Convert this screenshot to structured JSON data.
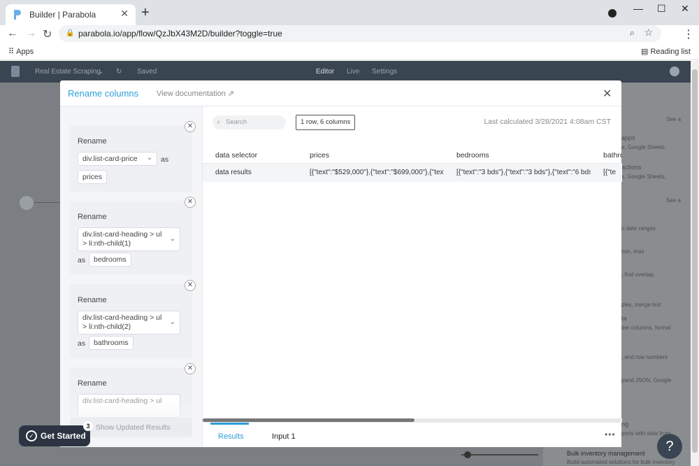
{
  "browser": {
    "tab_title": "Builder | Parabola",
    "url": "parabola.io/app/flow/QzJbX43M2D/builder?toggle=true",
    "apps_label": "Apps",
    "reading_list_label": "Reading list"
  },
  "appbar": {
    "flow_name": "Real Estate Scraping",
    "saved_label": "Saved",
    "tabs": [
      "Editor",
      "Live",
      "Settings"
    ]
  },
  "background": {
    "panel_texts": [
      "See a",
      "apps",
      "e, Google Sheets,",
      "actions",
      "s, Google Sheets,",
      "See a",
      "n date ranges",
      "min, max",
      ", find overlap,",
      "ples, merge text",
      "ta",
      "der columns, format",
      ", and row numbers",
      "pand JSON, Google",
      "ng",
      "ports with data from",
      "Bulk inventory management",
      "Build automated solutions for bulk inventory"
    ],
    "help_label": "?",
    "get_started_label": "Get Started",
    "get_started_count": "3"
  },
  "modal": {
    "title": "Rename columns",
    "view_doc_label": "View documentation",
    "rename_label": "Rename",
    "as_label": "as",
    "renames": [
      {
        "from": "div.list-card-price",
        "to": "prices"
      },
      {
        "from_line1": "div.list-card-heading > ul",
        "from_line2": "> li:nth-child(1)",
        "to": "bedrooms"
      },
      {
        "from_line1": "div.list-card-heading > ul",
        "from_line2": "> li:nth-child(2)",
        "to": "bathrooms"
      },
      {
        "from_line1": "div.list-card-heading > ul"
      }
    ],
    "show_updated_label": "Show Updated Results",
    "search_placeholder": "Search",
    "rows_badge": "1 row, 6 columns",
    "last_calculated": "Last calculated 3/28/2021 4:08am CST",
    "table": {
      "columns": [
        "data selector",
        "prices",
        "bedrooms",
        "bathrooms"
      ],
      "rows": [
        [
          "data results",
          "[{\"text\":\"$529,000\"},{\"text\":\"$699,000\"},{\"text\"",
          "[{\"text\":\"3 bds\"},{\"text\":\"3 bds\"},{\"text\":\"6 bds\"",
          "[{\"te"
        ]
      ]
    },
    "bottom_tabs": [
      "Results",
      "Input 1"
    ]
  },
  "colors": {
    "accent": "#2d9fd9",
    "appbar": "#3a4552"
  }
}
